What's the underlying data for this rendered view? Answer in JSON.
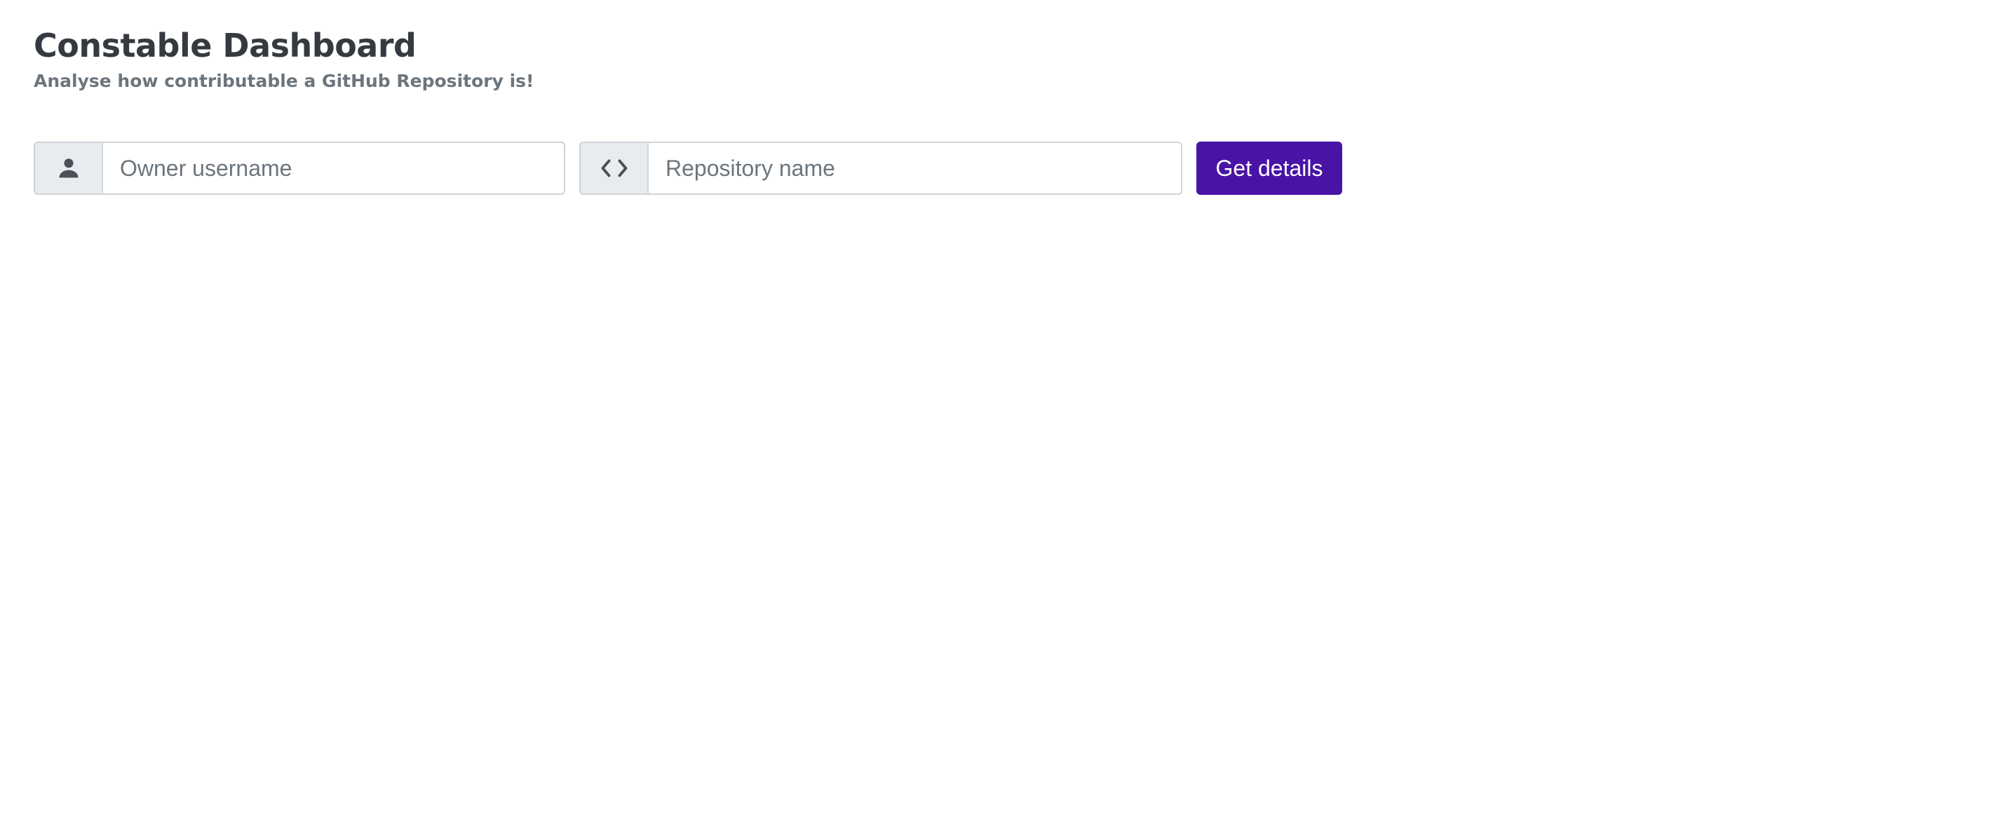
{
  "header": {
    "title": "Constable Dashboard",
    "subtitle": "Analyse how contributable a GitHub Repository is!"
  },
  "form": {
    "owner": {
      "icon": "user-icon",
      "value": "",
      "placeholder": "Owner username"
    },
    "repo": {
      "icon": "code-icon",
      "value": "",
      "placeholder": "Repository name"
    },
    "submit_label": "Get details"
  },
  "colors": {
    "accent": "#4914a6",
    "addon_background": "#e9ecef",
    "border": "#ced4da",
    "title": "#343a40",
    "subtitle": "#6c757d"
  }
}
